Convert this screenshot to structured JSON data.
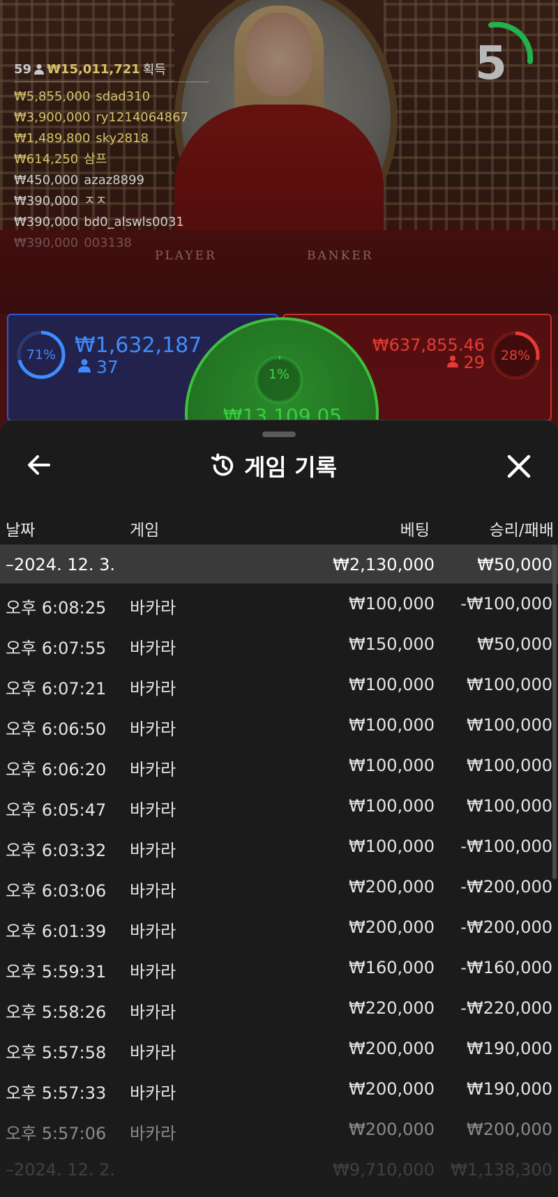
{
  "timer": {
    "value": "5",
    "color": "#22b14c"
  },
  "winners": {
    "count": "59",
    "total": "₩15,011,721",
    "suffix": "획득",
    "list": [
      {
        "amount": "₩5,855,000",
        "name": "sdad310"
      },
      {
        "amount": "₩3,900,000",
        "name": "ry1214064867"
      },
      {
        "amount": "₩1,489,800",
        "name": "sky2818"
      },
      {
        "amount": "₩614,250",
        "name": "삼프"
      },
      {
        "amount": "₩450,000",
        "name": "azaz8899"
      },
      {
        "amount": "₩390,000",
        "name": "ㅈㅈ"
      },
      {
        "amount": "₩390,000",
        "name": "bd0_alswls0031"
      },
      {
        "amount": "₩390,000",
        "name": "003138"
      }
    ]
  },
  "table": {
    "player_label": "PLAYER",
    "banker_label": "BANKER"
  },
  "bets": {
    "player": {
      "percent": "71%",
      "percent_value": 0.71,
      "amount": "₩1,632,187",
      "players": "37",
      "color": "#3e8dff"
    },
    "tie": {
      "percent": "1%",
      "percent_value": 0.01,
      "amount": "₩13,109.05",
      "color": "#37d13f"
    },
    "banker": {
      "percent": "28%",
      "percent_value": 0.28,
      "amount": "₩637,855.46",
      "players": "29",
      "color": "#e63b34"
    }
  },
  "history": {
    "title": "게임 기록",
    "columns": {
      "date": "날짜",
      "game": "게임",
      "bet": "베팅",
      "win": "승리/패배"
    },
    "day": {
      "label": "–2024. 12. 3.",
      "bet": "₩2,130,000",
      "win": "₩50,000"
    },
    "rows": [
      {
        "time": "오후 6:08:25",
        "game": "바카라",
        "bet": "₩100,000",
        "win": "-₩100,000"
      },
      {
        "time": "오후 6:07:55",
        "game": "바카라",
        "bet": "₩150,000",
        "win": "₩50,000"
      },
      {
        "time": "오후 6:07:21",
        "game": "바카라",
        "bet": "₩100,000",
        "win": "₩100,000"
      },
      {
        "time": "오후 6:06:50",
        "game": "바카라",
        "bet": "₩100,000",
        "win": "₩100,000"
      },
      {
        "time": "오후 6:06:20",
        "game": "바카라",
        "bet": "₩100,000",
        "win": "₩100,000"
      },
      {
        "time": "오후 6:05:47",
        "game": "바카라",
        "bet": "₩100,000",
        "win": "₩100,000"
      },
      {
        "time": "오후 6:03:32",
        "game": "바카라",
        "bet": "₩100,000",
        "win": "-₩100,000"
      },
      {
        "time": "오후 6:03:06",
        "game": "바카라",
        "bet": "₩200,000",
        "win": "-₩200,000"
      },
      {
        "time": "오후 6:01:39",
        "game": "바카라",
        "bet": "₩200,000",
        "win": "-₩200,000"
      },
      {
        "time": "오후 5:59:31",
        "game": "바카라",
        "bet": "₩160,000",
        "win": "-₩160,000"
      },
      {
        "time": "오후 5:58:26",
        "game": "바카라",
        "bet": "₩220,000",
        "win": "-₩220,000"
      },
      {
        "time": "오후 5:57:58",
        "game": "바카라",
        "bet": "₩200,000",
        "win": "₩190,000"
      },
      {
        "time": "오후 5:57:33",
        "game": "바카라",
        "bet": "₩200,000",
        "win": "₩190,000"
      },
      {
        "time": "오후 5:57:06",
        "game": "바카라",
        "bet": "₩200,000",
        "win": "₩200,000"
      }
    ],
    "next_day": {
      "label": "–2024. 12. 2.",
      "bet": "₩9,710,000",
      "win": "₩1,138,300"
    }
  }
}
